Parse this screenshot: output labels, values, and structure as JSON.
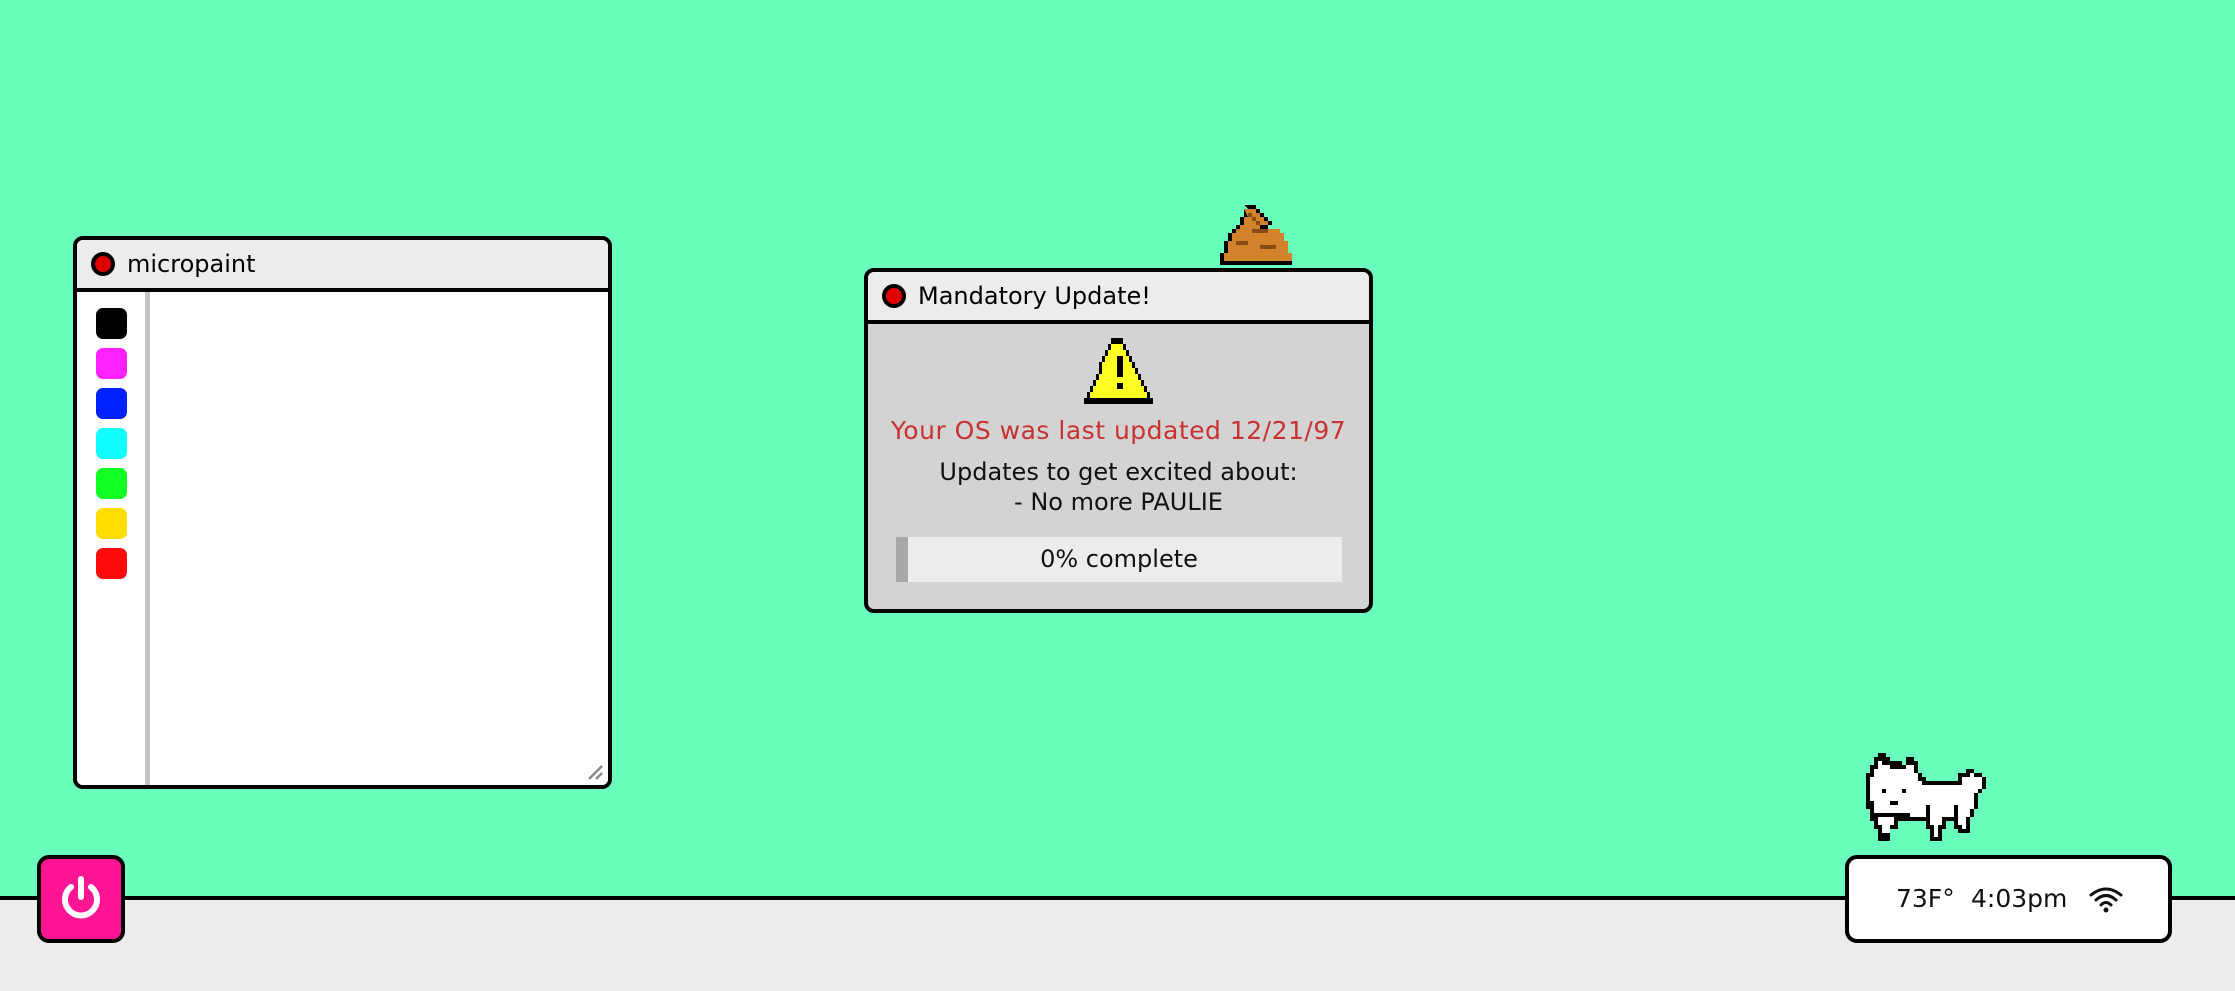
{
  "desktop": {
    "background_color": "#6bffbd"
  },
  "micropaint": {
    "title": "micropaint",
    "palette": [
      {
        "name": "black",
        "color": "#000000"
      },
      {
        "name": "magenta",
        "color": "#ff22ff"
      },
      {
        "name": "blue",
        "color": "#0022ff"
      },
      {
        "name": "cyan",
        "color": "#11ffff"
      },
      {
        "name": "green",
        "color": "#11ff22"
      },
      {
        "name": "yellow",
        "color": "#ffdd00"
      },
      {
        "name": "red",
        "color": "#ff0a0a"
      }
    ]
  },
  "update_dialog": {
    "title": "Mandatory Update!",
    "last_updated_text": "Your OS was last updated 12/21/97",
    "excited_text": "Updates to get excited about:",
    "feature_text": "- No more PAULIE",
    "progress_text": "0% complete",
    "progress_fraction": 0.0,
    "icon": "warning-icon"
  },
  "taskbar": {
    "power_icon": "power-icon",
    "power_color": "#ff1493",
    "temperature": "73F°",
    "time": "4:03pm",
    "wifi_icon": "wifi-icon"
  }
}
